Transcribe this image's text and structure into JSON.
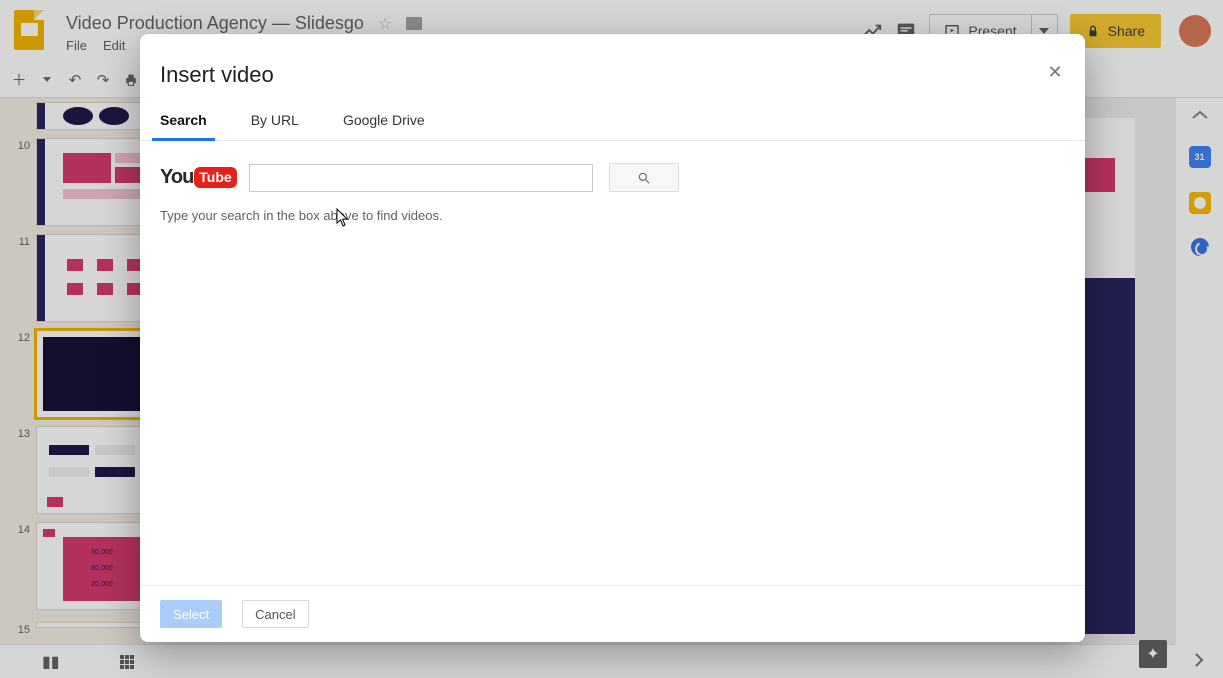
{
  "doc": {
    "title": "Video Production Agency — Slidesgo"
  },
  "menus": {
    "file": "File",
    "edit": "Edit"
  },
  "header": {
    "present": "Present",
    "share": "Share"
  },
  "thumbs": [
    {
      "num": ""
    },
    {
      "num": "10"
    },
    {
      "num": "11"
    },
    {
      "num": "12"
    },
    {
      "num": "13"
    },
    {
      "num": "14"
    },
    {
      "num": "15"
    }
  ],
  "modal": {
    "title": "Insert video",
    "tabs": {
      "search": "Search",
      "byurl": "By URL",
      "drive": "Google Drive"
    },
    "youtube_you": "You",
    "youtube_tube": "Tube",
    "search_value": "",
    "hint": "Type your search in the box above to find videos.",
    "select": "Select",
    "cancel": "Cancel"
  }
}
